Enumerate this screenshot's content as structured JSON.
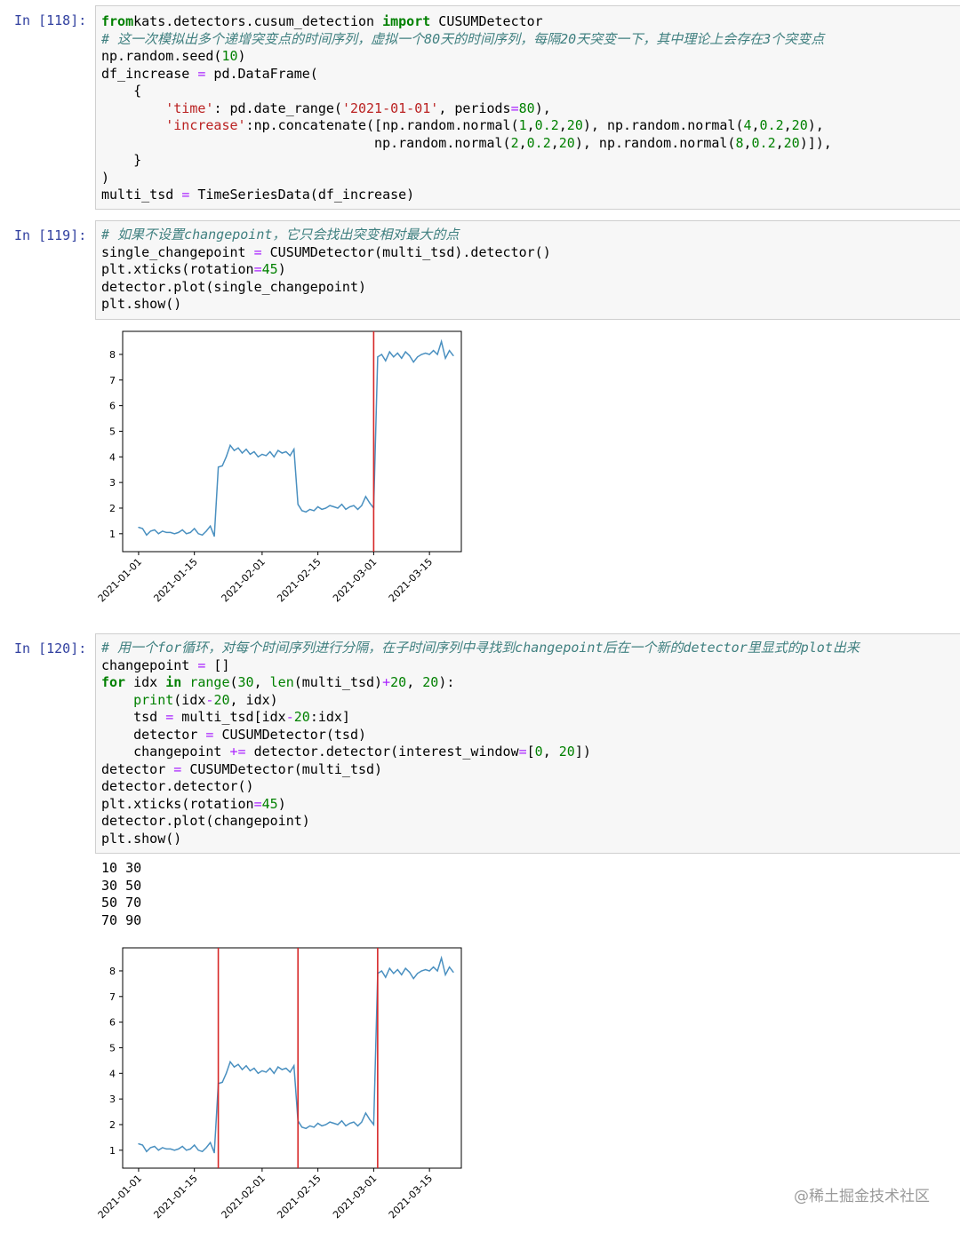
{
  "cells": [
    {
      "prompt": "In [118]:",
      "lines": [
        [
          [
            "kw",
            "from"
          ],
          [
            "",
            "kats.detectors.cusum_detection "
          ],
          [
            "kw",
            "import"
          ],
          [
            "",
            " CUSUMDetector"
          ]
        ],
        [
          [
            "cm",
            "# 这一次模拟出多个递增突变点的时间序列，虚拟一个80天的时间序列，每隔20天突变一下，其中理论上会存在3个突变点"
          ]
        ],
        [
          [
            "",
            "np.random.seed("
          ],
          [
            "num",
            "10"
          ],
          [
            "",
            ")"
          ]
        ],
        [
          [
            "",
            "df_increase "
          ],
          [
            "op",
            "="
          ],
          [
            "",
            " pd.DataFrame("
          ]
        ],
        [
          [
            "",
            "    {"
          ]
        ],
        [
          [
            "",
            "        "
          ],
          [
            "str",
            "'time'"
          ],
          [
            "",
            ": pd.date_range("
          ],
          [
            "str",
            "'2021-01-01'"
          ],
          [
            "",
            ", periods"
          ],
          [
            "op",
            "="
          ],
          [
            "num",
            "80"
          ],
          [
            "",
            "),"
          ]
        ],
        [
          [
            "",
            "        "
          ],
          [
            "str",
            "'increase'"
          ],
          [
            "",
            ":np.concatenate([np.random.normal("
          ],
          [
            "num",
            "1"
          ],
          [
            "",
            ","
          ],
          [
            "num",
            "0.2"
          ],
          [
            "",
            ","
          ],
          [
            "num",
            "20"
          ],
          [
            "",
            "), np.random.normal("
          ],
          [
            "num",
            "4"
          ],
          [
            "",
            ","
          ],
          [
            "num",
            "0.2"
          ],
          [
            "",
            ","
          ],
          [
            "num",
            "20"
          ],
          [
            "",
            "),"
          ]
        ],
        [
          [
            "",
            "                                  np.random.normal("
          ],
          [
            "num",
            "2"
          ],
          [
            "",
            ","
          ],
          [
            "num",
            "0.2"
          ],
          [
            "",
            ","
          ],
          [
            "num",
            "20"
          ],
          [
            "",
            "), np.random.normal("
          ],
          [
            "num",
            "8"
          ],
          [
            "",
            ","
          ],
          [
            "num",
            "0.2"
          ],
          [
            "",
            ","
          ],
          [
            "num",
            "20"
          ],
          [
            "",
            ")]),"
          ]
        ],
        [
          [
            "",
            "    }"
          ]
        ],
        [
          [
            "",
            ")"
          ]
        ],
        [
          [
            "",
            "multi_tsd "
          ],
          [
            "op",
            "="
          ],
          [
            "",
            " TimeSeriesData(df_increase)"
          ]
        ]
      ]
    },
    {
      "prompt": "In [119]:",
      "lines": [
        [
          [
            "cm",
            "# 如果不设置changepoint，它只会找出突变相对最大的点"
          ]
        ],
        [
          [
            "",
            "single_changepoint "
          ],
          [
            "op",
            "="
          ],
          [
            "",
            " CUSUMDetector(multi_tsd).detector()"
          ]
        ],
        [
          [
            "",
            "plt.xticks(rotation"
          ],
          [
            "op",
            "="
          ],
          [
            "num",
            "45"
          ],
          [
            "",
            ")"
          ]
        ],
        [
          [
            "",
            "detector.plot(single_changepoint)"
          ]
        ],
        [
          [
            "",
            "plt.show()"
          ]
        ]
      ]
    },
    {
      "prompt": "In [120]:",
      "lines": [
        [
          [
            "cm",
            "# 用一个for循环，对每个时间序列进行分隔，在子时间序列中寻找到changepoint后在一个新的detector里显式的plot出来"
          ]
        ],
        [
          [
            "",
            "changepoint "
          ],
          [
            "op",
            "="
          ],
          [
            "",
            " []"
          ]
        ],
        [
          [
            "kw",
            "for"
          ],
          [
            "",
            " idx "
          ],
          [
            "kw",
            "in"
          ],
          [
            "",
            " "
          ],
          [
            "bi",
            "range"
          ],
          [
            "",
            "("
          ],
          [
            "num",
            "30"
          ],
          [
            "",
            ", "
          ],
          [
            "bi",
            "len"
          ],
          [
            "",
            "(multi_tsd)"
          ],
          [
            "op",
            "+"
          ],
          [
            "num",
            "20"
          ],
          [
            "",
            ", "
          ],
          [
            "num",
            "20"
          ],
          [
            "",
            "):"
          ]
        ],
        [
          [
            "",
            "    "
          ],
          [
            "bi",
            "print"
          ],
          [
            "",
            "(idx"
          ],
          [
            "op",
            "-"
          ],
          [
            "num",
            "20"
          ],
          [
            "",
            ", idx)"
          ]
        ],
        [
          [
            "",
            "    tsd "
          ],
          [
            "op",
            "="
          ],
          [
            "",
            " multi_tsd[idx"
          ],
          [
            "op",
            "-"
          ],
          [
            "num",
            "20"
          ],
          [
            "",
            ":idx]"
          ]
        ],
        [
          [
            "",
            "    detector "
          ],
          [
            "op",
            "="
          ],
          [
            "",
            " CUSUMDetector(tsd)"
          ]
        ],
        [
          [
            "",
            "    changepoint "
          ],
          [
            "op",
            "+="
          ],
          [
            "",
            " detector.detector(interest_window"
          ],
          [
            "op",
            "="
          ],
          [
            "",
            "["
          ],
          [
            "num",
            "0"
          ],
          [
            "",
            ", "
          ],
          [
            "num",
            "20"
          ],
          [
            "",
            "])"
          ]
        ],
        [
          [
            "",
            "detector "
          ],
          [
            "op",
            "="
          ],
          [
            "",
            " CUSUMDetector(multi_tsd)"
          ]
        ],
        [
          [
            "",
            "detector.detector()"
          ]
        ],
        [
          [
            "",
            "plt.xticks(rotation"
          ],
          [
            "op",
            "="
          ],
          [
            "num",
            "45"
          ],
          [
            "",
            ")"
          ]
        ],
        [
          [
            "",
            "detector.plot(changepoint)"
          ]
        ],
        [
          [
            "",
            "plt.show()"
          ]
        ]
      ]
    }
  ],
  "stdout_lines": [
    "10 30",
    "30 50",
    "50 70",
    "70 90"
  ],
  "chart_data": [
    {
      "type": "line",
      "x_start": "2021-01-01",
      "x_ticks": [
        "2021-01-01",
        "2021-01-15",
        "2021-02-01",
        "2021-02-15",
        "2021-03-01",
        "2021-03-15"
      ],
      "y_ticks": [
        1,
        2,
        3,
        4,
        5,
        6,
        7,
        8
      ],
      "ylim": [
        0.3,
        8.9
      ],
      "xlim": [
        "2020-12-28",
        "2021-03-23"
      ],
      "series": [
        {
          "values": [
            1.25,
            1.2,
            0.95,
            1.1,
            1.15,
            1.0,
            1.1,
            1.05,
            1.05,
            1.0,
            1.05,
            1.15,
            1.0,
            1.05,
            1.2,
            1.0,
            0.95,
            1.1,
            1.3,
            0.9,
            3.6,
            3.65,
            4.0,
            4.45,
            4.25,
            4.35,
            4.15,
            4.3,
            4.1,
            4.2,
            4.0,
            4.1,
            4.05,
            4.2,
            4.0,
            4.25,
            4.15,
            4.2,
            4.05,
            4.3,
            2.15,
            1.9,
            1.85,
            1.95,
            1.9,
            2.05,
            1.95,
            2.0,
            2.1,
            2.05,
            2.0,
            2.15,
            1.95,
            2.05,
            2.1,
            1.95,
            2.1,
            2.45,
            2.2,
            2.0,
            7.9,
            8.0,
            7.75,
            8.1,
            7.9,
            8.05,
            7.85,
            8.1,
            7.95,
            7.7,
            7.9,
            8.0,
            8.05,
            8.0,
            8.15,
            8.0,
            8.5,
            7.85,
            8.15,
            7.95
          ]
        }
      ],
      "changepoints": [
        "2021-03-01"
      ],
      "line_color": "#4a90c0",
      "changepoint_color": "#d62728"
    },
    {
      "type": "line",
      "x_start": "2021-01-01",
      "x_ticks": [
        "2021-01-01",
        "2021-01-15",
        "2021-02-01",
        "2021-02-15",
        "2021-03-01",
        "2021-03-15"
      ],
      "y_ticks": [
        1,
        2,
        3,
        4,
        5,
        6,
        7,
        8
      ],
      "ylim": [
        0.3,
        8.9
      ],
      "xlim": [
        "2020-12-28",
        "2021-03-23"
      ],
      "series": [
        {
          "values": [
            1.25,
            1.2,
            0.95,
            1.1,
            1.15,
            1.0,
            1.1,
            1.05,
            1.05,
            1.0,
            1.05,
            1.15,
            1.0,
            1.05,
            1.2,
            1.0,
            0.95,
            1.1,
            1.3,
            0.9,
            3.6,
            3.65,
            4.0,
            4.45,
            4.25,
            4.35,
            4.15,
            4.3,
            4.1,
            4.2,
            4.0,
            4.1,
            4.05,
            4.2,
            4.0,
            4.25,
            4.15,
            4.2,
            4.05,
            4.3,
            2.15,
            1.9,
            1.85,
            1.95,
            1.9,
            2.05,
            1.95,
            2.0,
            2.1,
            2.05,
            2.0,
            2.15,
            1.95,
            2.05,
            2.1,
            1.95,
            2.1,
            2.45,
            2.2,
            2.0,
            7.9,
            8.0,
            7.75,
            8.1,
            7.9,
            8.05,
            7.85,
            8.1,
            7.95,
            7.7,
            7.9,
            8.0,
            8.05,
            8.0,
            8.15,
            8.0,
            8.5,
            7.85,
            8.15,
            7.95
          ]
        }
      ],
      "changepoints": [
        "2021-01-21",
        "2021-02-10",
        "2021-03-02"
      ],
      "line_color": "#4a90c0",
      "changepoint_color": "#d62728"
    }
  ],
  "watermark": "@稀土掘金技术社区"
}
